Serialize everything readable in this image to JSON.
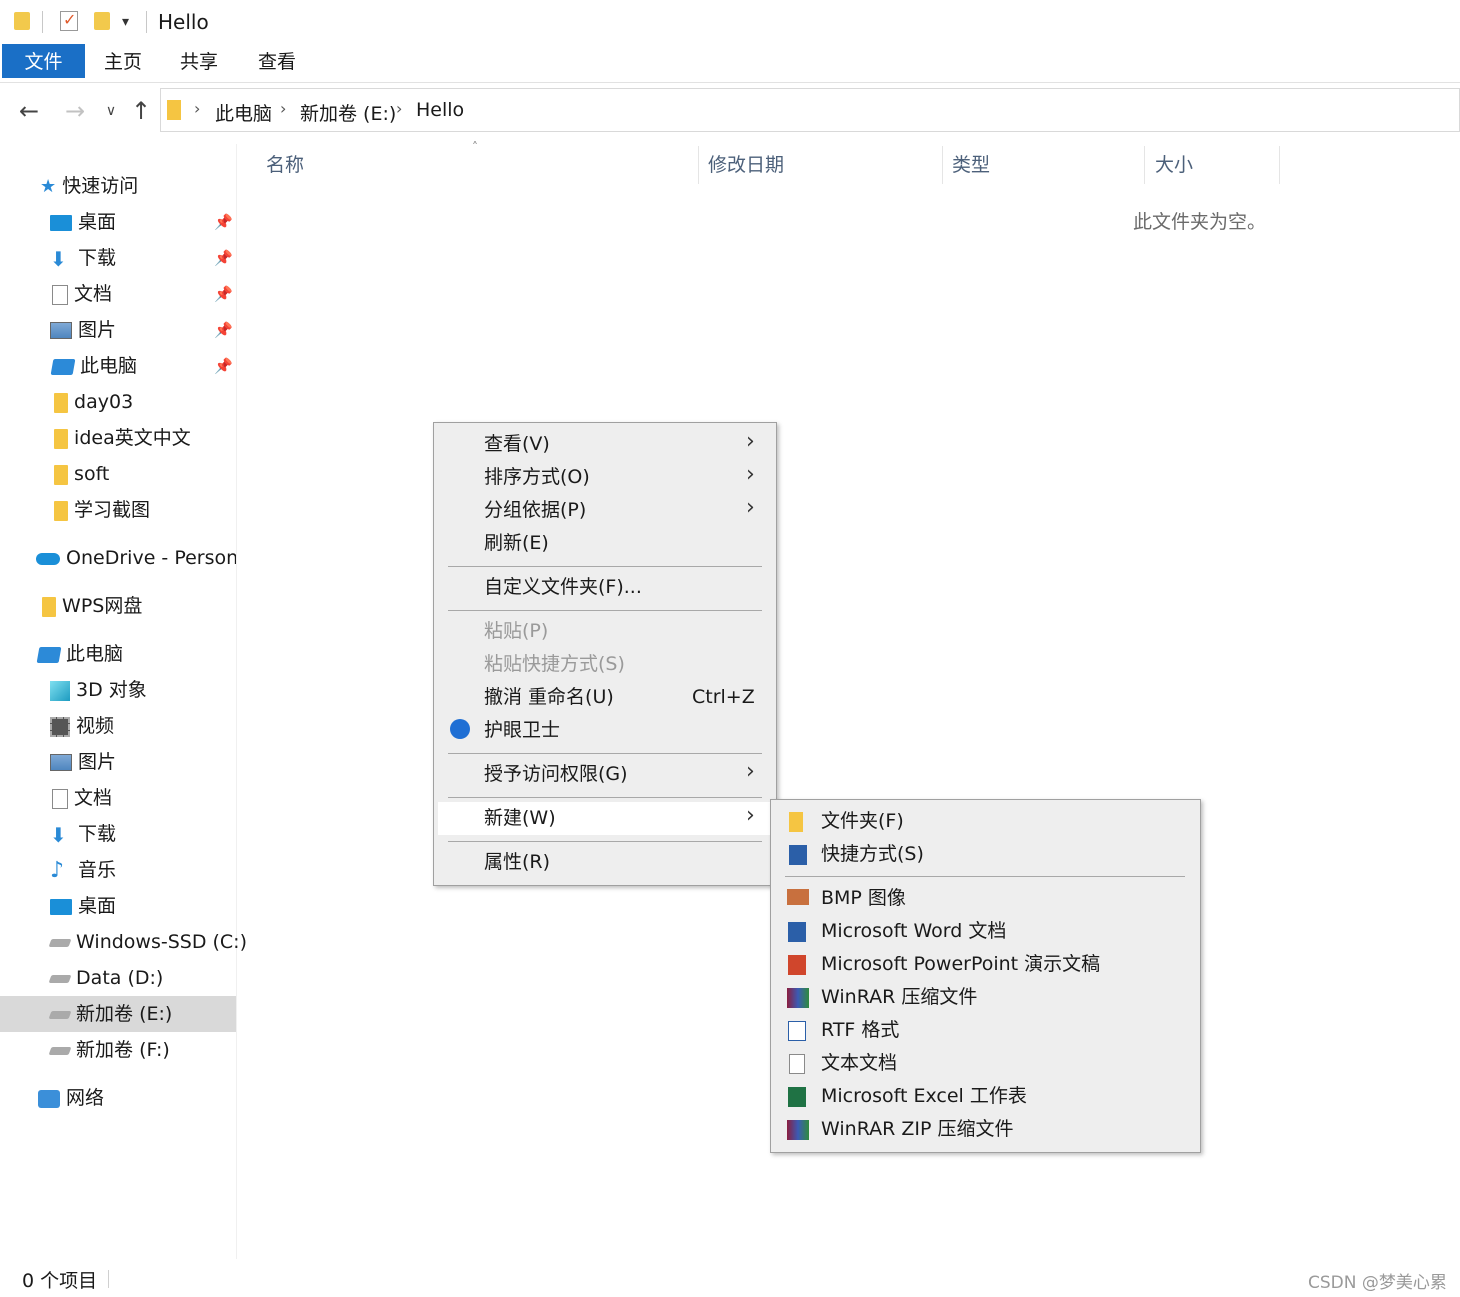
{
  "window": {
    "title": "Hello"
  },
  "ribbon": {
    "tabs": [
      "文件",
      "主页",
      "共享",
      "查看"
    ]
  },
  "address": {
    "crumbs": [
      "此电脑",
      "新加卷 (E:)",
      "Hello"
    ]
  },
  "sidebar": {
    "quick_access": "快速访问",
    "quick_items": [
      "桌面",
      "下载",
      "文档",
      "图片",
      "此电脑",
      "day03",
      "idea英文中文",
      "soft",
      "学习截图"
    ],
    "onedrive": "OneDrive - Personal",
    "wps": "WPS网盘",
    "this_pc": "此电脑",
    "pc_items": [
      "3D 对象",
      "视频",
      "图片",
      "文档",
      "下载",
      "音乐",
      "桌面",
      "Windows-SSD (C:)",
      "Data (D:)",
      "新加卷 (E:)",
      "新加卷 (F:)"
    ],
    "network": "网络"
  },
  "columns": [
    "名称",
    "修改日期",
    "类型",
    "大小"
  ],
  "empty_message": "此文件夹为空。",
  "context_menu": {
    "items": [
      "查看(V)",
      "排序方式(O)",
      "分组依据(P)",
      "刷新(E)",
      "自定义文件夹(F)...",
      "粘贴(P)",
      "粘贴快捷方式(S)",
      "撤消 重命名(U)",
      "护眼卫士",
      "授予访问权限(G)",
      "新建(W)",
      "属性(R)"
    ],
    "undo_shortcut": "Ctrl+Z"
  },
  "submenu": {
    "items": [
      "文件夹(F)",
      "快捷方式(S)",
      "BMP 图像",
      "Microsoft Word 文档",
      "Microsoft PowerPoint 演示文稿",
      "WinRAR 压缩文件",
      "RTF 格式",
      "文本文档",
      "Microsoft Excel 工作表",
      "WinRAR ZIP 压缩文件"
    ]
  },
  "status": {
    "count": "0 个项目"
  },
  "watermark": "CSDN @梦美心累"
}
